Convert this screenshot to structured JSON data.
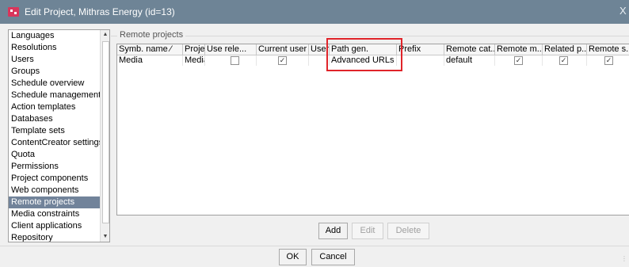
{
  "window": {
    "title": "Edit Project, Mithras Energy (id=13)",
    "close_glyph": "X"
  },
  "sidebar": {
    "items": [
      "Languages",
      "Resolutions",
      "Users",
      "Groups",
      "Schedule overview",
      "Schedule management",
      "Action templates",
      "Databases",
      "Template sets",
      "ContentCreator settings",
      "Quota",
      "Permissions",
      "Project components",
      "Web components",
      "Remote projects",
      "Media constraints",
      "Client applications",
      "Repository"
    ],
    "selected": "Remote projects"
  },
  "group": {
    "title": "Remote projects"
  },
  "table": {
    "headers": [
      "Symb. name ⁄",
      "Project",
      "Use rele...",
      "Current user",
      "User",
      "Path gen.",
      "Prefix",
      "Remote cat...",
      "Remote m...",
      "Related p...",
      "Remote s..."
    ],
    "rows": [
      {
        "symb_name": "Media",
        "project": "Media",
        "use_release": false,
        "current_user": true,
        "user": "",
        "path_gen": "Advanced URLs",
        "prefix": "",
        "remote_cat": "default",
        "remote_m": true,
        "related_p": true,
        "remote_s": true
      }
    ]
  },
  "buttons": {
    "add": "Add",
    "edit": "Edit",
    "delete": "Delete",
    "ok": "OK",
    "cancel": "Cancel"
  },
  "colors": {
    "titlebar": "#6e8496",
    "selection": "#71839a",
    "highlight": "#e0242a",
    "app_icon": "#d9355b"
  },
  "icons": {
    "app": "firstspirit-app-icon",
    "scroll_up": "▲",
    "scroll_down": "▼",
    "check": "✓"
  }
}
